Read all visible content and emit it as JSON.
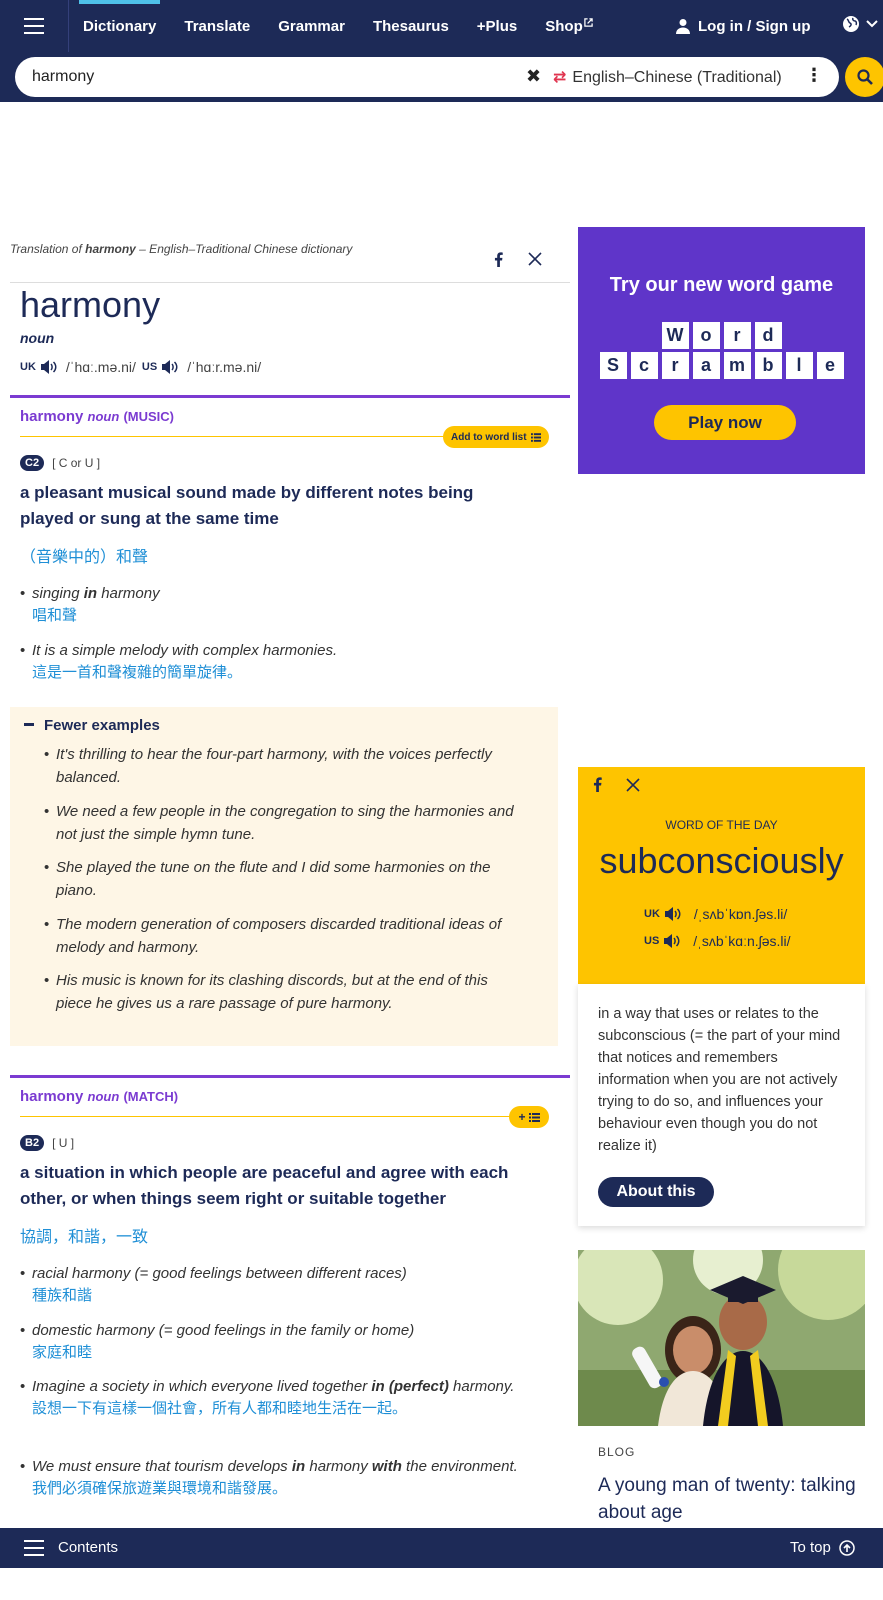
{
  "nav": {
    "links": [
      "Dictionary",
      "Translate",
      "Grammar",
      "Thesaurus",
      "+Plus",
      "Shop"
    ],
    "login": "Log in / Sign up"
  },
  "search": {
    "query": "harmony",
    "dictionary": "English–Chinese (Traditional)"
  },
  "entry": {
    "translation_of_prefix": "Translation of ",
    "translation_of_word": "harmony",
    "translation_of_suffix": " – English–Traditional Chinese dictionary",
    "headword": "harmony",
    "pos": "noun",
    "uk_label": "UK",
    "uk_ipa": "/ˈhɑː.mə.ni/",
    "us_label": "US",
    "us_ipa": "/ˈhɑːr.mə.ni/"
  },
  "senses": [
    {
      "headword": "harmony",
      "pos": "noun",
      "guideword": "(MUSIC)",
      "add_label": "Add to word list",
      "level": "C2",
      "grammar": "[ C or U ]",
      "definition": "a pleasant musical sound made by different notes being played or sung at the same time",
      "translation": "（音樂中的）和聲",
      "examples": [
        {
          "pre": "singing ",
          "bold": "in",
          "post": " harmony",
          "trans": "唱和聲"
        },
        {
          "pre": "It is a simple melody with complex harmonies.",
          "bold": "",
          "post": "",
          "trans": "這是一首和聲複雜的簡單旋律。"
        }
      ],
      "fewer_label": "Fewer examples",
      "more_examples": [
        "It's thrilling to hear the four-part harmony, with the voices perfectly balanced.",
        "We need a few people in the congregation to sing the harmonies and not just the simple hymn tune.",
        "She played the tune on the flute and I did some harmonies on the piano.",
        "The modern generation of composers discarded traditional ideas of melody and harmony.",
        "His music is known for its clashing discords, but at the end of this piece he gives us a rare passage of pure harmony."
      ]
    },
    {
      "headword": "harmony",
      "pos": "noun",
      "guideword": "(MATCH)",
      "level": "B2",
      "grammar": "[ U ]",
      "definition": "a situation in which people are peaceful and agree with each other, or when things seem right or suitable together",
      "translation": "協調，和諧，一致",
      "examples": [
        {
          "pre": "racial harmony (= good feelings between different races)",
          "trans": "種族和諧"
        },
        {
          "pre": "domestic harmony (= good feelings in the family or home)",
          "trans": "家庭和睦"
        },
        {
          "pre": "Imagine a society in which everyone lived together ",
          "bold": "in (perfect)",
          "post": " harmony.",
          "trans": "設想一下有這樣一個社會，所有人都和睦地生活在一起。"
        },
        {
          "pre": "We must ensure that tourism develops ",
          "bold": "in",
          "mid": " harmony ",
          "bold2": "with",
          "post": " the environment.",
          "trans": "我們必須確保旅遊業與環境和諧發展。"
        }
      ]
    }
  ],
  "game_ad": {
    "title": "Try our new word game",
    "row1": [
      "W",
      "o",
      "r",
      "d"
    ],
    "row2": [
      "S",
      "c",
      "r",
      "a",
      "m",
      "b",
      "l",
      "e"
    ],
    "button": "Play now"
  },
  "wotd": {
    "label": "WORD OF THE DAY",
    "word": "subconsciously",
    "uk_label": "UK",
    "uk_ipa": "/ˌsʌbˈkɒn.ʃəs.li/",
    "us_label": "US",
    "us_ipa": "/ˌsʌbˈkɑːn.ʃəs.li/",
    "definition": "in a way that uses or relates to the subconscious (= the part of your mind that notices and remembers information when you are not actively trying to do so, and influences your behaviour even though you do not realize it)",
    "button": "About this"
  },
  "blog": {
    "tag": "BLOG",
    "title": "A young man of twenty: talking about age"
  },
  "bottom": {
    "contents": "Contents",
    "totop": "To top"
  },
  "colors": {
    "navy": "#1d2a57",
    "yellow": "#fec400",
    "purple": "#5f35c9",
    "sense_purple": "#7b3bd1",
    "translation_blue": "#1f8fd6"
  }
}
